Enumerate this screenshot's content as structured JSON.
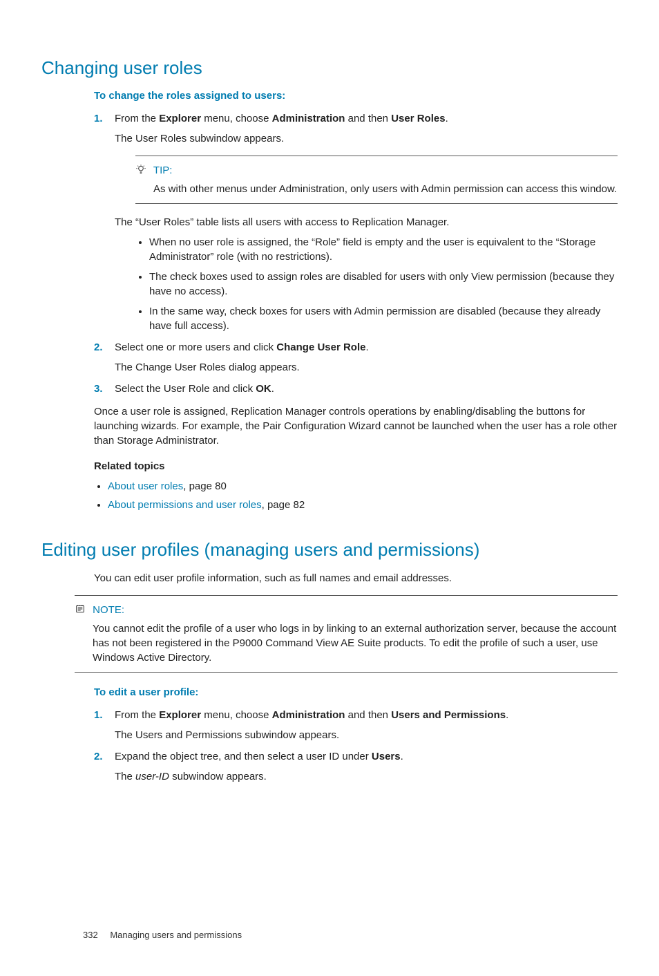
{
  "section1": {
    "heading": "Changing user roles",
    "subhead": "To change the roles assigned to users:",
    "step1_a": "From the ",
    "step1_b": "Explorer",
    "step1_c": " menu, choose ",
    "step1_d": "Administration",
    "step1_e": " and then ",
    "step1_f": "User Roles",
    "step1_g": ".",
    "step1_sub": "The User Roles subwindow appears.",
    "tip_label": "TIP:",
    "tip_body": "As with other menus under Administration, only users with Admin permission can access this window.",
    "after_tip": "The “User Roles” table lists all users with access to Replication Manager.",
    "bullets": [
      "When no user role is assigned, the “Role” field is empty and the user is equivalent to the “Storage Administrator” role (with no restrictions).",
      "The check boxes used to assign roles are disabled for users with only View permission (because they have no access).",
      "In the same way, check boxes for users with Admin permission are disabled (because they already have full access)."
    ],
    "step2_a": "Select one or more users and click ",
    "step2_b": "Change User Role",
    "step2_c": ".",
    "step2_sub": "The Change User Roles dialog appears.",
    "step3_a": "Select the User Role and click ",
    "step3_b": "OK",
    "step3_c": ".",
    "after_steps": "Once a user role is assigned, Replication Manager controls operations by enabling/disabling the buttons for launching wizards. For example, the Pair Configuration Wizard cannot be launched when the user has a role other than Storage Administrator.",
    "related_head": "Related topics",
    "rel1_link": "About user roles",
    "rel1_tail": ", page 80",
    "rel2_link": "About permissions and user roles",
    "rel2_tail": ", page 82"
  },
  "section2": {
    "heading": "Editing user profiles (managing users and permissions)",
    "intro": "You can edit user profile information, such as full names and email addresses.",
    "note_label": "NOTE:",
    "note_body": "You cannot edit the profile of a user who logs in by linking to an external authorization server, because the account has not been registered in the P9000 Command View AE Suite products. To edit the profile of such a user, use Windows Active Directory.",
    "subhead": "To edit a user profile:",
    "step1_a": "From the ",
    "step1_b": "Explorer",
    "step1_c": " menu, choose ",
    "step1_d": "Administration",
    "step1_e": " and then ",
    "step1_f": "Users and Permissions",
    "step1_g": ".",
    "step1_sub": "The Users and Permissions subwindow appears.",
    "step2_a": "Expand the object tree, and then select a user ID under ",
    "step2_b": "Users",
    "step2_c": ".",
    "step2_sub_a": "The ",
    "step2_sub_b": "user-ID",
    "step2_sub_c": " subwindow appears."
  },
  "footer": {
    "page": "332",
    "title": "Managing users and permissions"
  },
  "nums": {
    "n1": "1.",
    "n2": "2.",
    "n3": "3."
  }
}
